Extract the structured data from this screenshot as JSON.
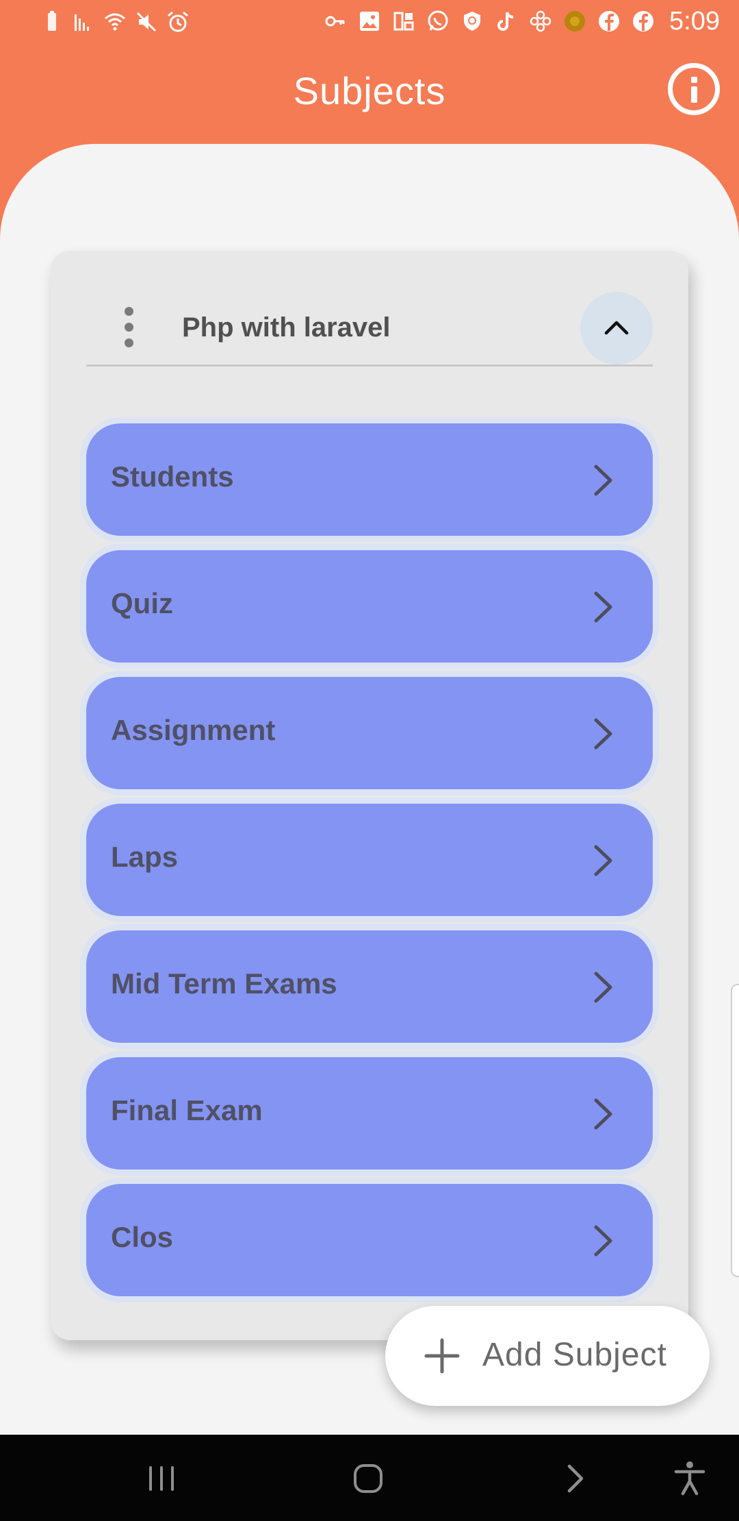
{
  "status_bar": {
    "time": "5:09",
    "left_icons": [
      "battery-icon",
      "signal-icon",
      "wifi-icon",
      "mute-icon",
      "alarm-icon"
    ],
    "right_icons": [
      "key-icon",
      "image-icon",
      "apps-icon",
      "whatsapp-icon",
      "shield-icon",
      "tiktok-icon",
      "flower-icon",
      "coin-icon",
      "facebook-icon",
      "facebook-icon"
    ]
  },
  "app_bar": {
    "title": "Subjects",
    "info_icon": "info-icon"
  },
  "subject_card": {
    "name": "Php with laravel",
    "expanded": true,
    "items": [
      {
        "label": "Students"
      },
      {
        "label": "Quiz"
      },
      {
        "label": "Assignment"
      },
      {
        "label": "Laps"
      },
      {
        "label": "Mid Term Exams"
      },
      {
        "label": "Final Exam"
      },
      {
        "label": "Clos"
      }
    ]
  },
  "fab": {
    "label": "Add Subject",
    "icon": "plus-icon"
  },
  "nav_bar": {
    "buttons": [
      "recent-apps-icon",
      "home-icon",
      "back-icon",
      "accessibility-icon"
    ]
  },
  "colors": {
    "header": "#F57B54",
    "sheet": "#F4F4F4",
    "card": "#E8E8E8",
    "item": "#8494F2",
    "item_glow": "#DCE3F3",
    "collapse_button": "#D8E2EC",
    "nav_bar": "#050505"
  }
}
